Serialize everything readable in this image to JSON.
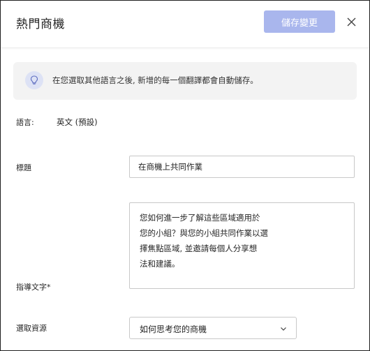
{
  "header": {
    "title": "熱門商機",
    "save_label": "儲存變更",
    "close_icon": "close-icon"
  },
  "info": {
    "icon": "lightbulb-icon",
    "text": "在您選取其他語言之後, 新增的每一個翻譯都會自動儲存。"
  },
  "form": {
    "language_label": "語言:",
    "language_value": "英文 (預設)",
    "title_label": "標題",
    "title_value": "在商機上共同作業",
    "guidance_label": "指導文字*",
    "guidance_lines": [
      "您如何進一步了解這些區域適用於",
      "您的小組？與您的小組共同作業以選",
      "擇焦點區域, 並邀請每個人分享想",
      "法和建議。"
    ],
    "resource_label": "選取資源",
    "resource_value": "如何思考您的商機",
    "resource_icon": "chevron-down-icon"
  },
  "colors": {
    "save_button": "#a9b6ed",
    "info_background": "#f3f3f3",
    "icon_circle": "#dde2f5"
  }
}
